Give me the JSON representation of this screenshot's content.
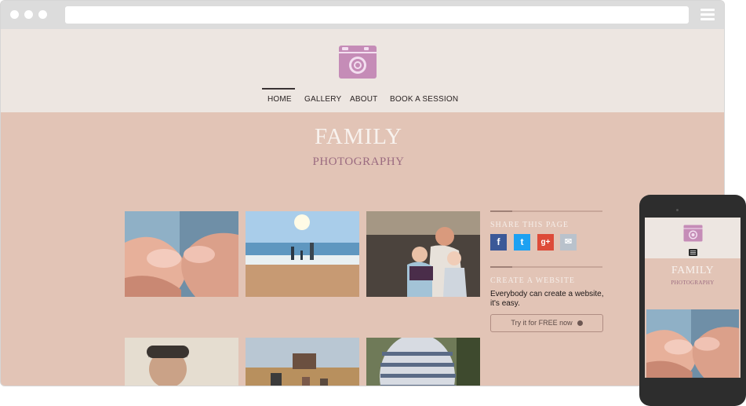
{
  "nav": {
    "items": [
      {
        "label": "HOME",
        "active": true
      },
      {
        "label": "GALLERY",
        "active": false
      },
      {
        "label": "ABOUT",
        "active": false
      },
      {
        "label": "BOOK A SESSION",
        "active": false
      }
    ]
  },
  "hero": {
    "title": "FAMILY",
    "subtitle": "PHOTOGRAPHY"
  },
  "gallery": [
    {
      "name": "baby-feet-in-hands"
    },
    {
      "name": "family-on-beach"
    },
    {
      "name": "mother-with-children-on-sofa"
    },
    {
      "name": "smiling-man"
    },
    {
      "name": "family-walking-in-field"
    },
    {
      "name": "pregnant-woman-striped-shirt"
    }
  ],
  "sidebar": {
    "share_heading": "SHARE THIS PAGE",
    "social": [
      {
        "icon": "facebook-icon",
        "glyph": "f",
        "color": "#3b5998"
      },
      {
        "icon": "twitter-icon",
        "glyph": "t",
        "color": "#1da1f2"
      },
      {
        "icon": "google-plus-icon",
        "glyph": "g+",
        "color": "#dd4b39"
      },
      {
        "icon": "email-icon",
        "glyph": "✉",
        "color": "#b9c2cc"
      }
    ],
    "create_heading": "CREATE A WEBSITE",
    "create_text": "Everybody can create a website, it's easy.",
    "cta_label": "Try it for FREE now"
  },
  "mobile": {
    "title": "FAMILY",
    "subtitle": "PHOTOGRAPHY"
  },
  "colors": {
    "header_bg": "#ede6e1",
    "main_bg": "#e2c4b6",
    "logo_pink": "#c58cb7",
    "accent_mauve": "#9b6b80"
  }
}
